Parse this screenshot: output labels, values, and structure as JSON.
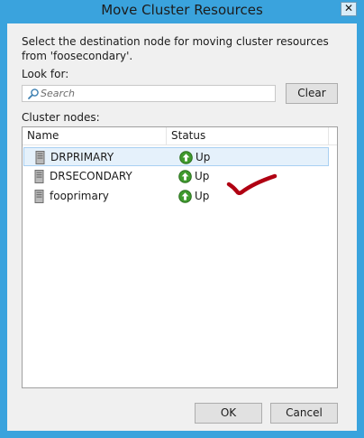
{
  "window": {
    "title": "Move Cluster Resources",
    "close_label": "✕"
  },
  "dialog": {
    "prompt": "Select the destination node for moving cluster resources from 'foosecondary'.",
    "look_for_label": "Look for:",
    "search": {
      "placeholder": "Search",
      "value": ""
    },
    "clear_label": "Clear",
    "nodes_label": "Cluster nodes:",
    "columns": {
      "name": "Name",
      "status": "Status"
    },
    "nodes": [
      {
        "name": "DRPRIMARY",
        "status": "Up",
        "selected": true,
        "icon": "server-icon",
        "status_icon": "up-arrow-icon"
      },
      {
        "name": "DRSECONDARY",
        "status": "Up",
        "selected": false,
        "icon": "server-icon",
        "status_icon": "up-arrow-icon"
      },
      {
        "name": "fooprimary",
        "status": "Up",
        "selected": false,
        "icon": "server-icon",
        "status_icon": "up-arrow-icon"
      }
    ],
    "ok_label": "OK",
    "cancel_label": "Cancel"
  },
  "colors": {
    "frame": "#3aa3dd",
    "selection": "#e5f1fb",
    "status_up": "#3f9a2e",
    "annotation": "#b00012"
  }
}
